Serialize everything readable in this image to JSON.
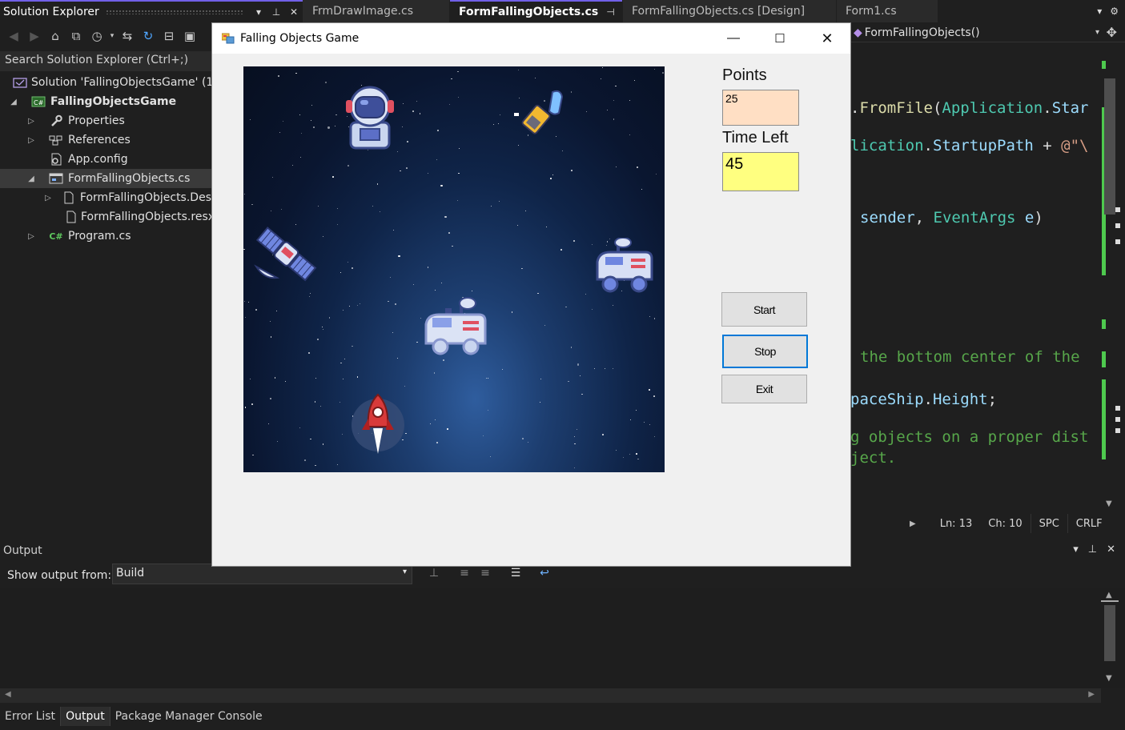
{
  "solution_explorer": {
    "title": "Solution Explorer",
    "search_placeholder": "Search Solution Explorer (Ctrl+;)",
    "tree": [
      {
        "label": "Solution 'FallingObjectsGame' (1",
        "icon": "solution-icon",
        "expander": ""
      },
      {
        "label": "FallingObjectsGame",
        "icon": "csharp-project-icon",
        "expander": "expanded"
      },
      {
        "label": "Properties",
        "icon": "wrench-icon",
        "expander": "collapsed"
      },
      {
        "label": "References",
        "icon": "references-icon",
        "expander": "collapsed"
      },
      {
        "label": "App.config",
        "icon": "config-file-icon",
        "expander": ""
      },
      {
        "label": "FormFallingObjects.cs",
        "icon": "form-icon",
        "expander": "expanded",
        "selected": true
      },
      {
        "label": "FormFallingObjects.Des",
        "icon": "file-icon",
        "expander": "collapsed"
      },
      {
        "label": "FormFallingObjects.resx",
        "icon": "file-icon",
        "expander": ""
      },
      {
        "label": "Program.cs",
        "icon": "csharp-file-icon",
        "expander": "collapsed",
        "icon_text": "C#"
      }
    ]
  },
  "editor": {
    "tabs": [
      {
        "label": "FrmDrawImage.cs",
        "active": false
      },
      {
        "label": "FormFallingObjects.cs",
        "active": true
      },
      {
        "label": "FormFallingObjects.cs [Design]",
        "active": false
      },
      {
        "label": "Form1.cs",
        "active": false
      }
    ],
    "member_dropdown": "FormFallingObjects()",
    "code_fragments": {
      "line1": [
        ".",
        "FromFile",
        "(",
        "Application",
        ".",
        "Star"
      ],
      "line2": [
        "lication",
        ".",
        "StartupPath",
        " + ",
        "@\"\\"
      ],
      "line3": [
        "sender",
        ", ",
        "EventArgs",
        " e",
        ")"
      ],
      "line4": "the bottom center of the ",
      "line5": [
        "paceShip",
        ".",
        "Height",
        ";"
      ],
      "line6": "g objects on a proper dist",
      "line7": "ject."
    },
    "status": {
      "line": "Ln: 13",
      "col": "Ch: 10",
      "spacing": "SPC",
      "eol": "CRLF"
    }
  },
  "output": {
    "title": "Output",
    "show_output_from_label": "Show output from:",
    "source": "Build",
    "bottom_tabs": [
      "Error List",
      "Output",
      "Package Manager Console"
    ],
    "active_tab": "Output"
  },
  "game_window": {
    "title": "Falling Objects Game",
    "points_label": "Points",
    "points_value": "25",
    "points_bg": "#ffdfc4",
    "time_label": "Time Left",
    "time_value": "45",
    "time_bg": "#ffff80",
    "buttons": {
      "start": "Start",
      "stop": "Stop",
      "exit": "Exit"
    },
    "sprites": [
      "astronaut-icon",
      "rocket-pod-icon",
      "satellite-icon",
      "rover-icon",
      "rover-icon",
      "rocket-icon"
    ]
  },
  "colors": {
    "accent": "#7160e8",
    "focus_blue": "#0078d7"
  }
}
